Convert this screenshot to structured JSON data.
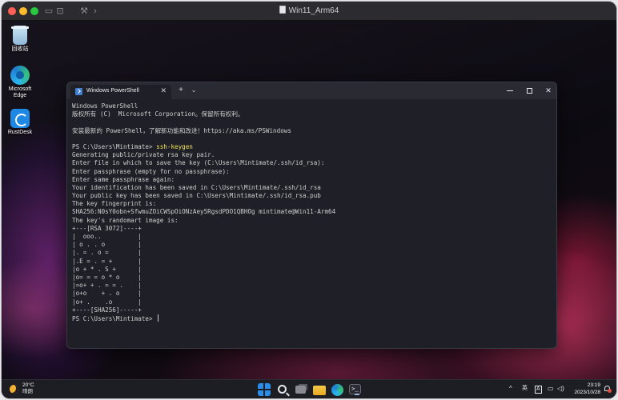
{
  "vm": {
    "title": "Win11_Arm64",
    "toolbar_icons": [
      "sidebar-icon",
      "screenshot-icon",
      "settings-icon",
      "forward-icon"
    ]
  },
  "desktop": {
    "icons": [
      {
        "label": "回收站",
        "icon": "recycle-bin-icon"
      },
      {
        "label": "Microsoft Edge",
        "icon": "edge-icon"
      },
      {
        "label": "RustDesk",
        "icon": "rustdesk-icon"
      }
    ]
  },
  "terminal": {
    "tab_title": "Windows PowerShell",
    "tab_close": "✕",
    "new_tab": "+",
    "dropdown": "⌄",
    "controls": {
      "close": "✕"
    },
    "lines": [
      {
        "text": "Windows PowerShell"
      },
      {
        "text": "版权所有 (C)  Microsoft Corporation。保留所有权利。"
      },
      {
        "text": ""
      },
      {
        "text": "安装最新的 PowerShell，了解新功能和改进！https://aka.ms/PSWindows"
      },
      {
        "text": ""
      },
      {
        "text": "PS C:\\Users\\Mintimate> ",
        "cmd": "ssh-keygen"
      },
      {
        "text": "Generating public/private rsa key pair."
      },
      {
        "text": "Enter file in which to save the key (C:\\Users\\Mintimate/.ssh/id_rsa):"
      },
      {
        "text": "Enter passphrase (empty for no passphrase):"
      },
      {
        "text": "Enter same passphrase again:"
      },
      {
        "text": "Your identification has been saved in C:\\Users\\Mintimate/.ssh/id_rsa"
      },
      {
        "text": "Your public key has been saved in C:\\Users\\Mintimate/.ssh/id_rsa.pub"
      },
      {
        "text": "The key fingerprint is:"
      },
      {
        "text": "SHA256:N0sY0obn+SfwmuZOiCWSpOiONzAey5RgsdPDO1QBHOg mintimate@Win11-Arm64"
      },
      {
        "text": "The key's randomart image is:"
      },
      {
        "text": "+---[RSA 3072]----+"
      },
      {
        "text": "|  ooo..          |"
      },
      {
        "text": "| o . . o         |"
      },
      {
        "text": "|. = . o =        |"
      },
      {
        "text": "|.E = . = +       |"
      },
      {
        "text": "|o + * . S +      |"
      },
      {
        "text": "|o= = = o * o     |"
      },
      {
        "text": "|=o+ + . = = .    |"
      },
      {
        "text": "|o+o    + . o     |"
      },
      {
        "text": "|o+ .    .o       |"
      },
      {
        "text": "+----[SHA256]-----+"
      },
      {
        "text": "PS C:\\Users\\Mintimate> ",
        "cursor": true
      }
    ]
  },
  "taskbar": {
    "weather": {
      "temp": "20°C",
      "condition": "晴朗"
    },
    "apps": [
      "start-icon",
      "search-icon",
      "task-view-icon",
      "file-explorer-icon",
      "edge-icon",
      "terminal-icon"
    ],
    "tray": {
      "chevron": "^",
      "ime": "英",
      "ime_mode": "A"
    },
    "clock": {
      "time": "23:19",
      "date": "2023/10/28"
    }
  },
  "colors": {
    "command": "#f2e35b",
    "terminal_bg": "#1f1f27",
    "taskbar_bg": "#1d1d24"
  }
}
